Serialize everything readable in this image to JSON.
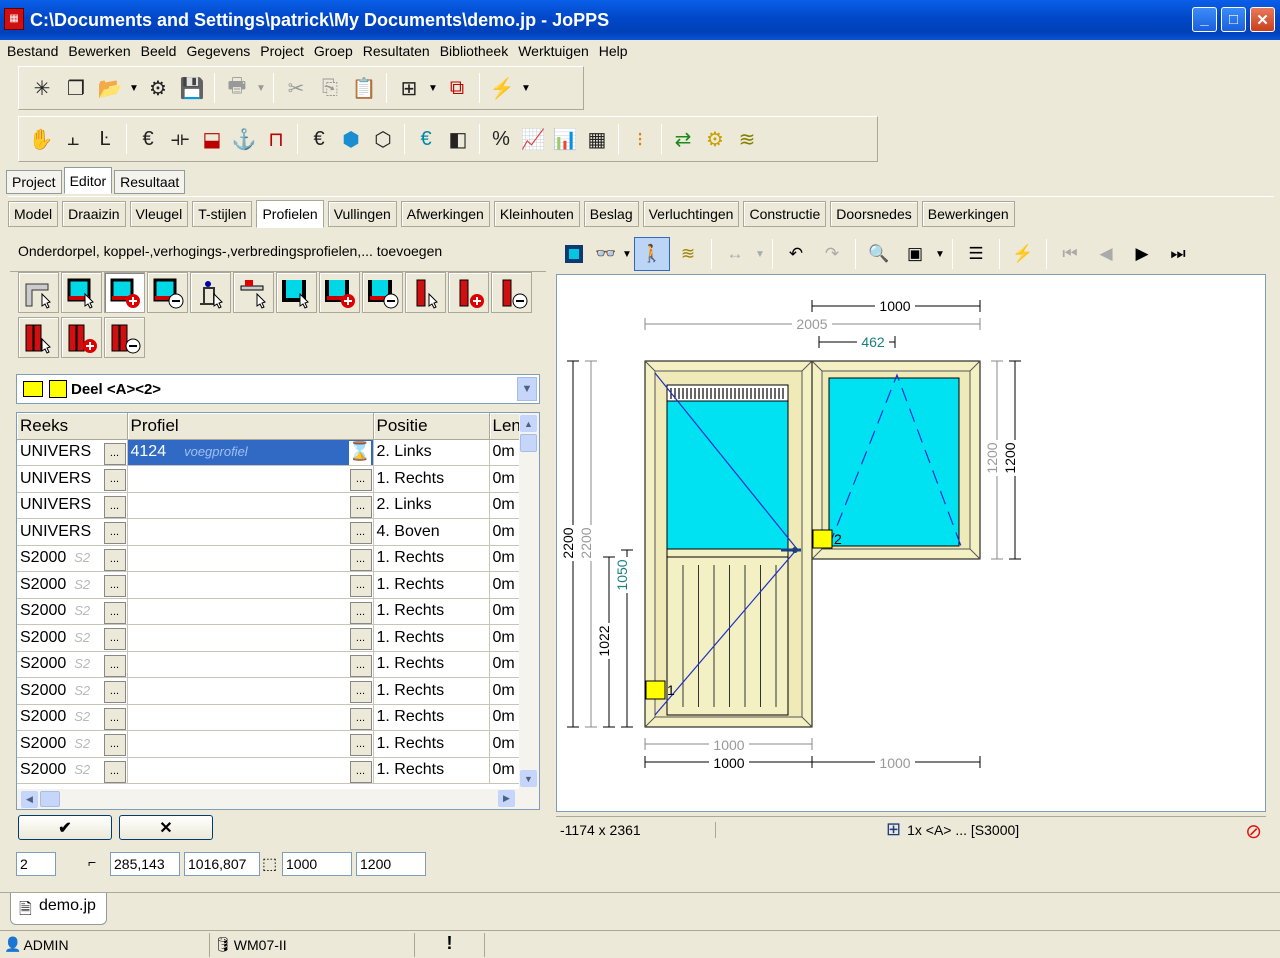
{
  "window": {
    "title": "C:\\Documents and Settings\\patrick\\My Documents\\demo.jp - JoPPS",
    "minimize": "_",
    "maximize": "□",
    "close": "✕"
  },
  "menu": [
    "Bestand",
    "Bewerken",
    "Beeld",
    "Gegevens",
    "Project",
    "Groep",
    "Resultaten",
    "Bibliotheek",
    "Werktuigen",
    "Help"
  ],
  "main_tabs": [
    "Project",
    "Editor",
    "Resultaat"
  ],
  "sub_tabs": [
    "Model",
    "Draaizin",
    "Vleugel",
    "T-stijlen",
    "Profielen",
    "Vullingen",
    "Afwerkingen",
    "Kleinhouten",
    "Beslag",
    "Verluchtingen",
    "Constructie",
    "Doorsnedes",
    "Bewerkingen"
  ],
  "panel": {
    "heading": "Onderdorpel, koppel-,verhogings-,verbredingsprofielen,... toevoegen",
    "selector": "Deel <A><2>",
    "columns": [
      "Reeks",
      "Profiel",
      "Positie",
      "Len"
    ],
    "rows": [
      {
        "reeks": "UNIVERS",
        "profiel": "4124",
        "ghost": "voegprofiel",
        "positie": "2. Links",
        "len": "0m"
      },
      {
        "reeks": "UNIVERS",
        "profiel": "",
        "ghost": "",
        "positie": "1. Rechts",
        "len": "0m"
      },
      {
        "reeks": "UNIVERS",
        "profiel": "",
        "ghost": "",
        "positie": "2. Links",
        "len": "0m"
      },
      {
        "reeks": "UNIVERS",
        "profiel": "",
        "ghost": "",
        "positie": "4. Boven",
        "len": "0m"
      },
      {
        "reeks": "S2000",
        "profiel": "",
        "ghost": "S2",
        "positie": "1. Rechts",
        "len": "0m"
      },
      {
        "reeks": "S2000",
        "profiel": "",
        "ghost": "S2",
        "positie": "1. Rechts",
        "len": "0m"
      },
      {
        "reeks": "S2000",
        "profiel": "",
        "ghost": "S2",
        "positie": "1. Rechts",
        "len": "0m"
      },
      {
        "reeks": "S2000",
        "profiel": "",
        "ghost": "S2",
        "positie": "1. Rechts",
        "len": "0m"
      },
      {
        "reeks": "S2000",
        "profiel": "",
        "ghost": "S2",
        "positie": "1. Rechts",
        "len": "0m"
      },
      {
        "reeks": "S2000",
        "profiel": "",
        "ghost": "S2",
        "positie": "1. Rechts",
        "len": "0m"
      },
      {
        "reeks": "S2000",
        "profiel": "",
        "ghost": "S2",
        "positie": "1. Rechts",
        "len": "0m"
      },
      {
        "reeks": "S2000",
        "profiel": "",
        "ghost": "S2",
        "positie": "1. Rechts",
        "len": "0m"
      },
      {
        "reeks": "S2000",
        "profiel": "",
        "ghost": "S2",
        "positie": "1. Rechts",
        "len": "0m"
      }
    ],
    "ok": "✔",
    "cancel": "✕",
    "fields": {
      "part": "2",
      "pos_x": "285,143",
      "pos_y": "1016,807",
      "width": "1000",
      "height": "1200"
    }
  },
  "drawing": {
    "dims": {
      "top_width": "1000",
      "overall": "2005",
      "offset": "462",
      "right_h1": "1200",
      "right_h2": "1200",
      "left_h1": "2200",
      "left_h2": "2200",
      "mid_h": "1050",
      "mid_h2": "1022",
      "bottom1": "1000",
      "bottom2": "1000",
      "bottom3": "1000"
    },
    "tags": {
      "part1": "1",
      "part2": "2"
    },
    "status_coords": "-1174 x 2361",
    "status_info": "1x <A> ... [S3000]"
  },
  "doc_tab": "demo.jp",
  "status": {
    "user": "ADMIN",
    "db": "WM07-II",
    "alert": "!"
  },
  "colors": {
    "frame": "#f3f0c4",
    "glass": "#00e2f2",
    "accent": "#316ac5"
  }
}
